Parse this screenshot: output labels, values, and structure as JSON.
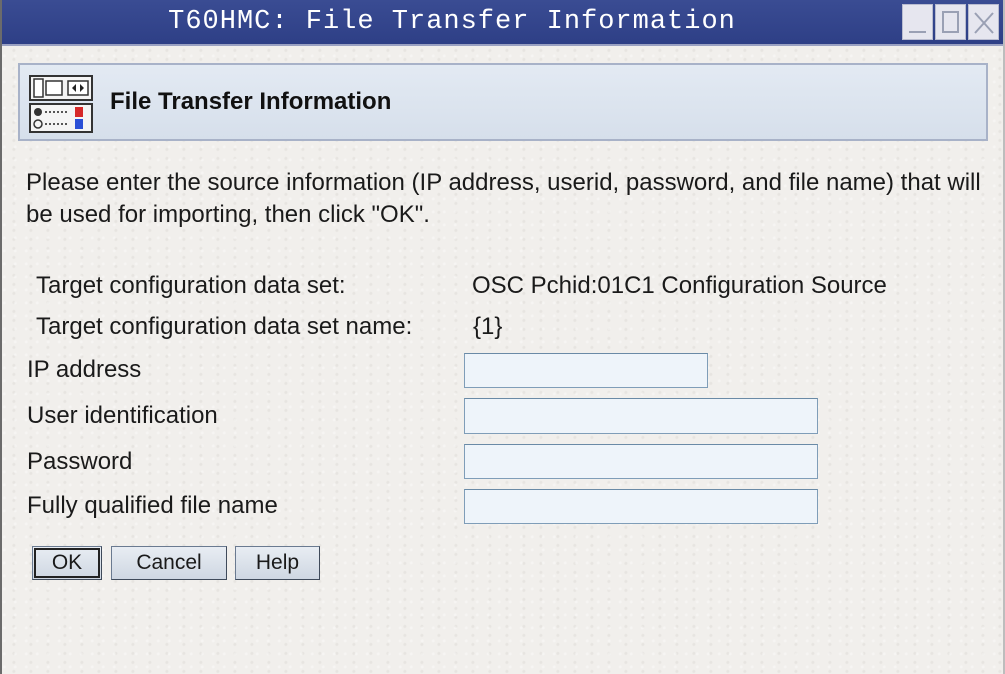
{
  "window": {
    "title": "T60HMC: File Transfer Information"
  },
  "header": {
    "icon": "hardware-panel-icon",
    "title": "File Transfer Information"
  },
  "instructions": "Please enter the source information (IP address, userid, password, and file name) that will be used for importing, then click \"OK\".",
  "target": {
    "data_set_label": "Target configuration data set:",
    "data_set_value": "OSC Pchid:01C1 Configuration Source",
    "data_set_name_label": "Target configuration data set name:",
    "data_set_name_value": "{1}"
  },
  "fields": {
    "ip_label": "IP address",
    "ip_value": "",
    "user_label": "User identification",
    "user_value": "",
    "password_label": "Password",
    "password_value": "",
    "filename_label": "Fully qualified file name",
    "filename_value": ""
  },
  "buttons": {
    "ok": "OK",
    "cancel": "Cancel",
    "help": "Help"
  },
  "colors": {
    "titlebar": "#2e3f86",
    "header_panel": "#d6dfeb",
    "field_background": "#eef4fa"
  }
}
